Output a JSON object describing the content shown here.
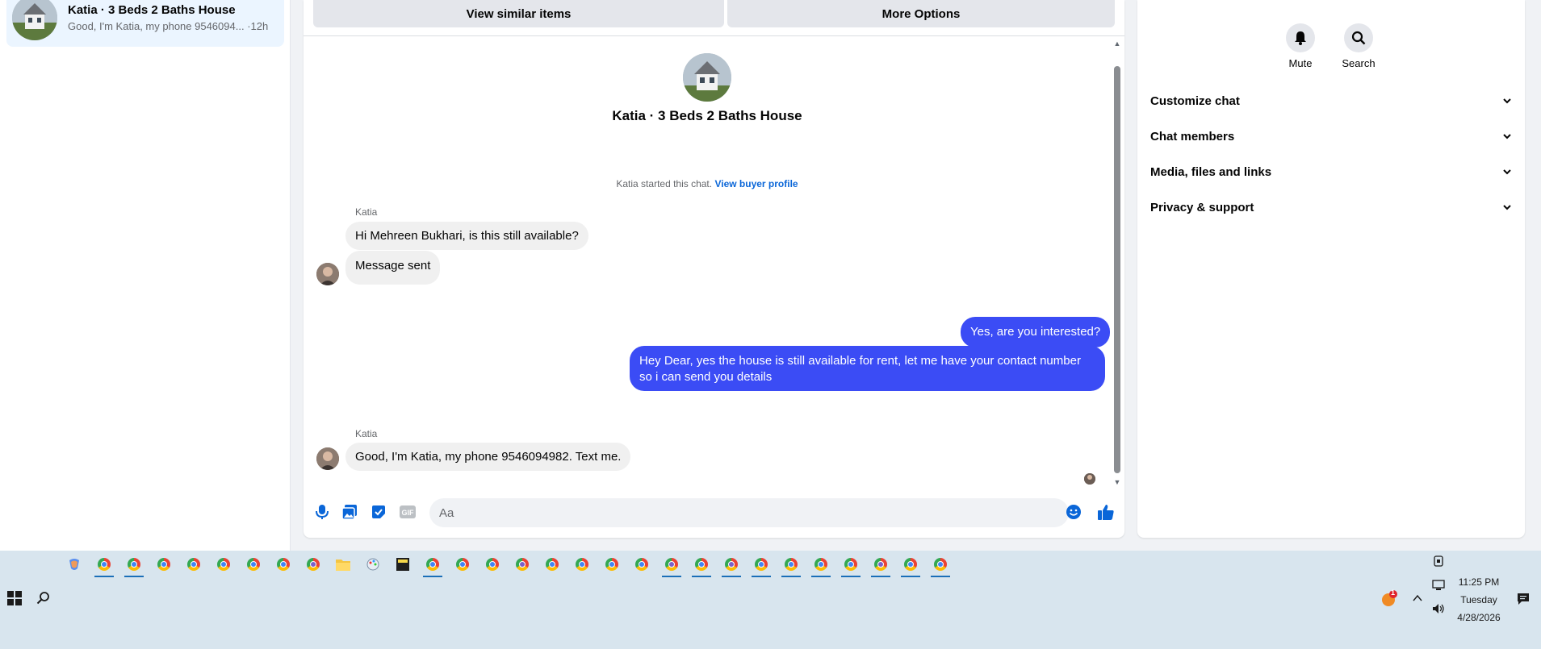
{
  "conversation_list": {
    "active_item": {
      "title": "Katia · 3 Beds 2 Baths House",
      "snippet": "Good, I'm Katia, my phone 9546094...",
      "time": "·12h"
    }
  },
  "chat": {
    "top_buttons": {
      "similar_label": "View similar items",
      "more_label": "More Options"
    },
    "header_name": "Katia · 3 Beds 2 Baths House",
    "started_text": "Katia started this chat.",
    "buyer_profile_link": "View buyer profile",
    "messages": [
      {
        "sender": "Katia",
        "text": "Hi Mehreen Bukhari, is this still available?"
      },
      {
        "text": "Message sent"
      },
      {
        "text": "Yes, are you interested?"
      },
      {
        "text": "Hey Dear, yes the house is still available for rent, let me have your contact number so i can send you details"
      },
      {
        "sender": "Katia",
        "text": "Good, I'm Katia, my phone 9546094982. Text me."
      }
    ],
    "composer": {
      "placeholder": "Aa",
      "icons": [
        "microphone-icon",
        "photo-icon",
        "sticker-icon",
        "gif-icon",
        "emoji-icon",
        "thumbs-up-icon"
      ]
    },
    "colors": {
      "outgoing_bubble": "#3b4cf5",
      "incoming_bubble": "#f0f0f0",
      "accent": "#0a66d8"
    }
  },
  "info_panel": {
    "actions": [
      {
        "label": "Mute",
        "icon": "bell-icon"
      },
      {
        "label": "Search",
        "icon": "search-icon"
      }
    ],
    "sections": [
      "Customize chat",
      "Chat members",
      "Media, files and links",
      "Privacy & support"
    ]
  },
  "taskbar": {
    "clock": {
      "time": "11:25 PM",
      "day": "Tuesday",
      "date": "4/28/2026"
    },
    "notification_badge": "1"
  }
}
